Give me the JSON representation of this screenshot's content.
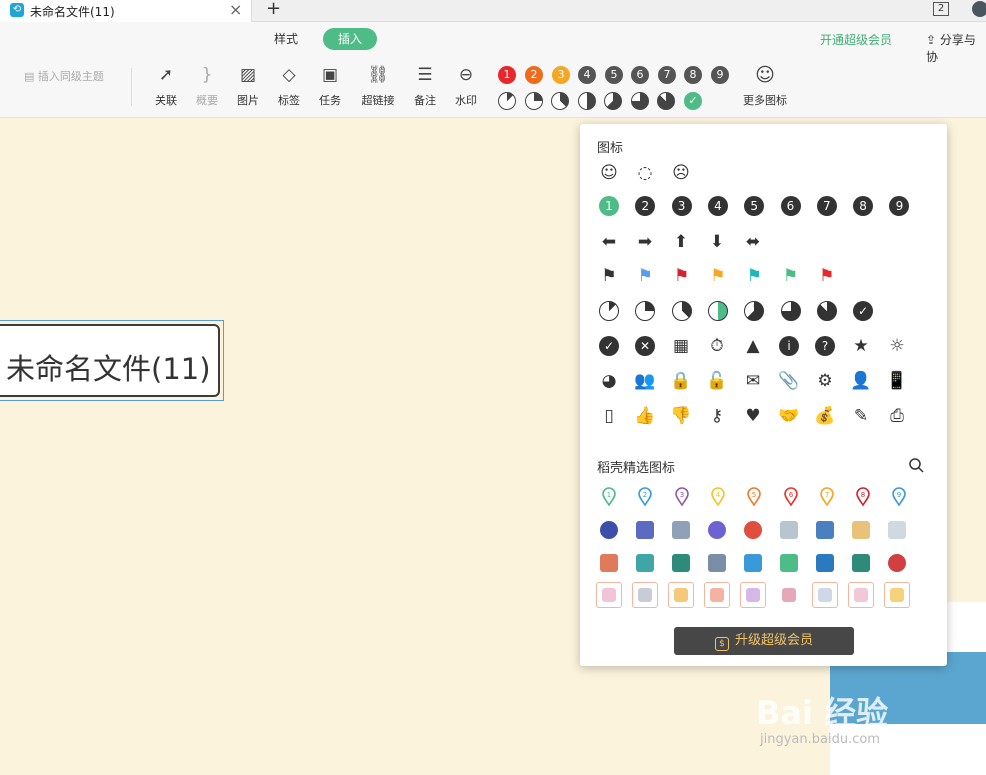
{
  "tab": {
    "title": "未命名文件(11)",
    "badge": "2"
  },
  "menu": {
    "style": "样式",
    "insert": "插入",
    "vip": "开通超级会员",
    "share": "分享与协"
  },
  "toolbar": {
    "sibling": "插入同级主题",
    "items": [
      "关联",
      "概要",
      "图片",
      "标签",
      "任务",
      "超链接",
      "备注",
      "水印"
    ],
    "more": "更多图标",
    "priorities": [
      "1",
      "2",
      "3",
      "4",
      "5",
      "6",
      "7",
      "8",
      "9"
    ],
    "priority_colors": [
      "#e8262b",
      "#f06a1c",
      "#f5a623",
      "#555555",
      "#555555",
      "#555555",
      "#555555",
      "#555555",
      "#555555"
    ]
  },
  "node": {
    "text": "未命名文件(11)"
  },
  "panel": {
    "title_icons": "图标",
    "title_curated": "稻壳精选图标",
    "upgrade": "升级超级会员",
    "numbers": [
      "1",
      "2",
      "3",
      "4",
      "5",
      "6",
      "7",
      "8",
      "9"
    ],
    "flag_colors": [
      "#333333",
      "#5b9cf3",
      "#d0252f",
      "#f5a623",
      "#1fb8b8",
      "#4ebc86",
      "#e8262b"
    ],
    "pin_colors": [
      "#4ebc86",
      "#3a9ad9",
      "#8e5ca8",
      "#f5c32c",
      "#f07b2c",
      "#e8342c",
      "#f5a623",
      "#d0252f",
      "#3a9ad9"
    ]
  },
  "watermark": {
    "text": "Bai 经验",
    "url": "jingyan.baidu.com"
  }
}
